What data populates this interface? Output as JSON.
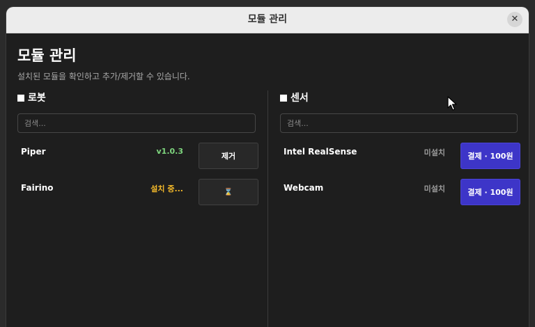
{
  "window": {
    "title": "모듈 관리",
    "close_label": "✕"
  },
  "page": {
    "title": "모듈 관리",
    "subtitle": "설치된 모듈을 확인하고 추가/제거할 수 있습니다."
  },
  "robots": {
    "title": "로봇",
    "search_placeholder": "검색...",
    "items": [
      {
        "name": "Piper",
        "status": "v1.0.3",
        "button": "제거"
      },
      {
        "name": "Fairino",
        "status": "설치 중...",
        "button": "⌛"
      }
    ]
  },
  "sensors": {
    "title": "센서",
    "search_placeholder": "검색...",
    "items": [
      {
        "name": "Intel RealSense",
        "status": "미설치",
        "button": "결제 · 100원"
      },
      {
        "name": "Webcam",
        "status": "미설치",
        "button": "결제 · 100원"
      }
    ]
  },
  "colors": {
    "installed": "#7ed67e",
    "installing": "#f2b82a",
    "not_installed": "#9a9a9a",
    "purchase_button": "#3d35c8"
  }
}
